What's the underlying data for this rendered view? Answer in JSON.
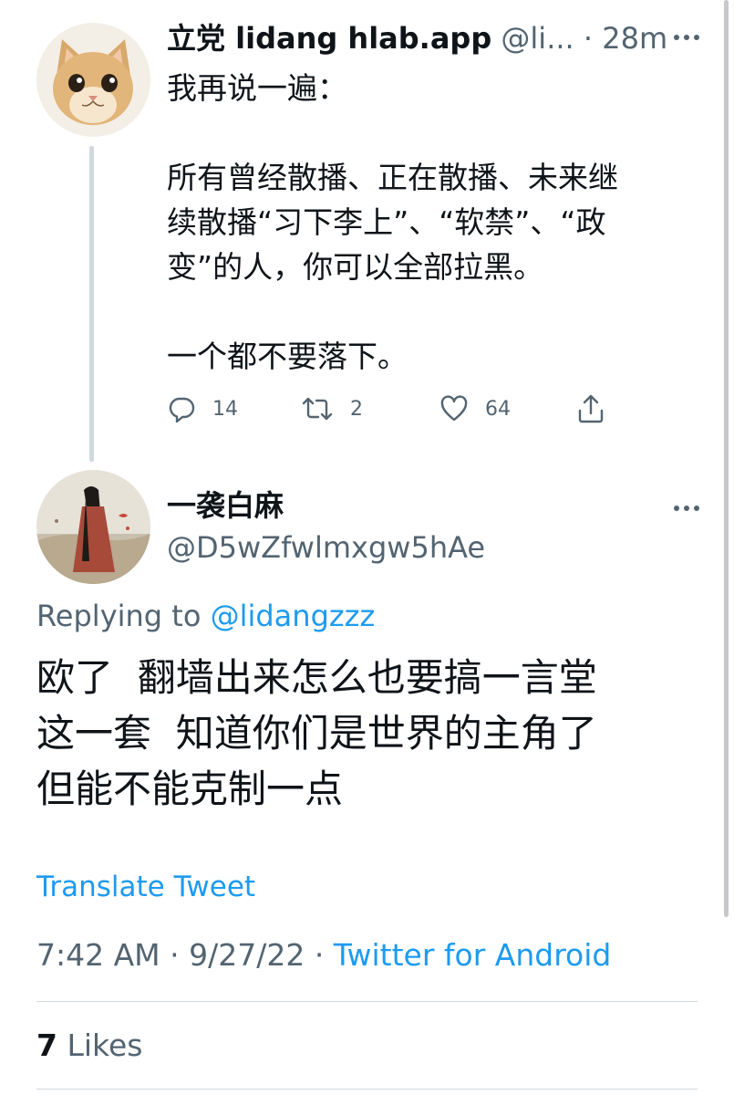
{
  "tweet1": {
    "name": "立党 lidang hlab.app",
    "handle": "@li...",
    "separator": "·",
    "time": "28m",
    "body": [
      "我再说一遍：",
      "",
      "所有曾经散播、正在散播、未来继",
      "续散播“习下李上”、“软禁”、“政",
      "变”的人，你可以全部拉黑。",
      "",
      "一个都不要落下。"
    ],
    "actions": {
      "reply_count": "14",
      "retweet_count": "2",
      "like_count": "64"
    }
  },
  "tweet2": {
    "name": "一袭白麻",
    "handle": "@D5wZfwlmxgw5hAe",
    "replying_prefix": "Replying to ",
    "replying_to": "@lidangzzz",
    "body": [
      "欧了  翻墙出来怎么也要搞一言堂",
      "这一套  知道你们是世界的主角了",
      "但能不能克制一点"
    ],
    "translate_label": "Translate Tweet",
    "timestamp": "7:42 AM · 9/27/22 · ",
    "source": "Twitter for Android",
    "likes_count": "7",
    "likes_label": " Likes"
  },
  "colors": {
    "accent": "#1d9bf0",
    "text_primary": "#0f1419",
    "text_secondary": "#536471",
    "thread_line": "#cfd9de"
  },
  "icons": [
    "more-icon",
    "reply-icon",
    "retweet-icon",
    "like-icon",
    "share-icon"
  ]
}
